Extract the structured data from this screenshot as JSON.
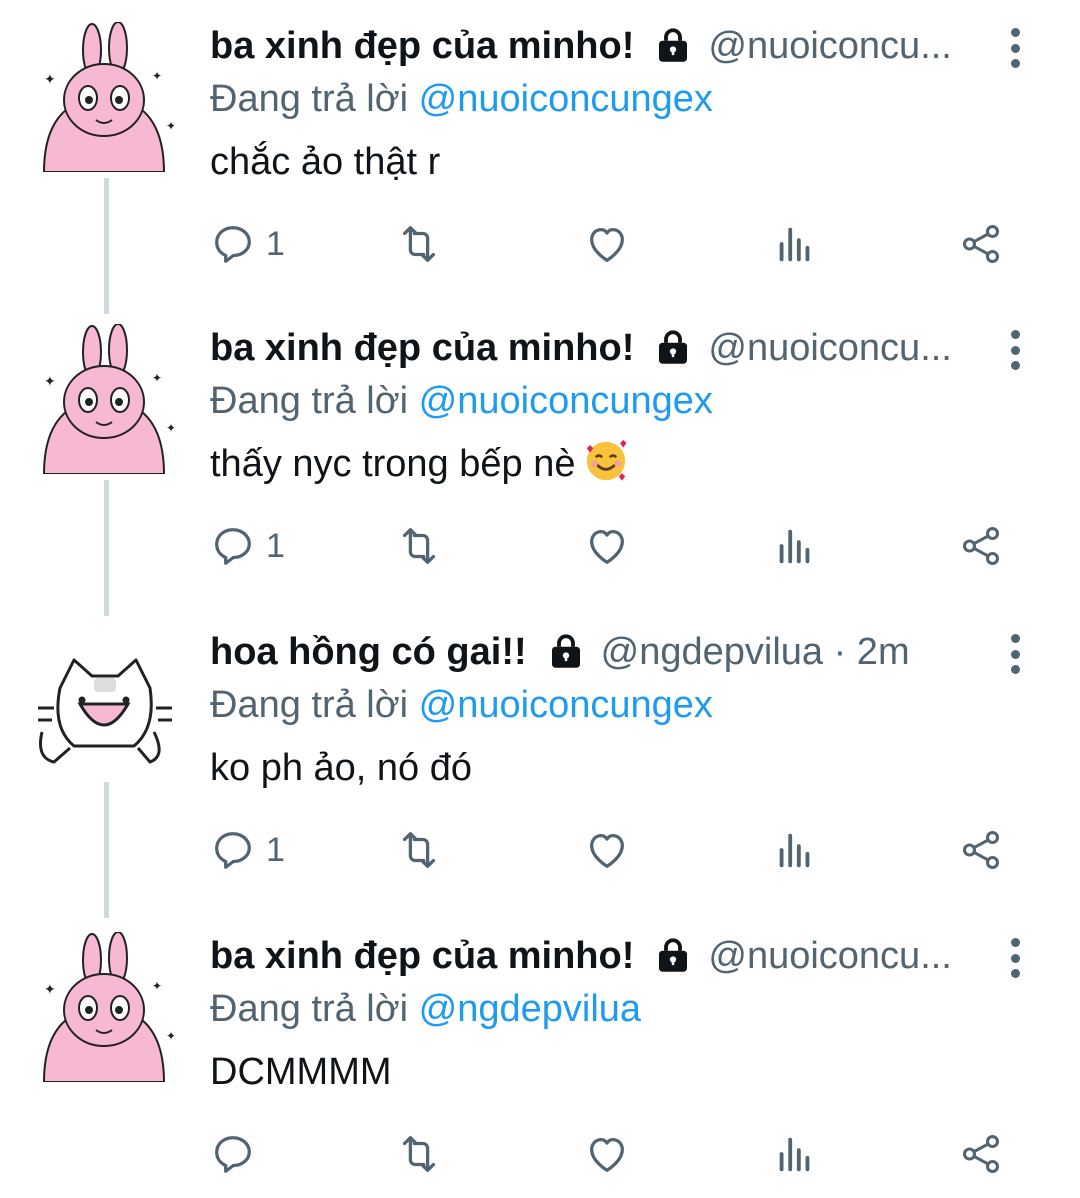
{
  "tweets": [
    {
      "name": "ba xinh đẹp của minho!",
      "handle": "@nuoiconcu...",
      "reply_prefix": "Đang trả lời",
      "reply_to": "@nuoiconcungex",
      "text": "chắc ảo thật r",
      "reply_count": "1",
      "avatar": "pink-bunny-avatar"
    },
    {
      "name": "ba xinh đẹp của minho!",
      "handle": "@nuoiconcu...",
      "reply_prefix": "Đang trả lời",
      "reply_to": "@nuoiconcungex",
      "text": "thấy nyc trong bếp nè",
      "emoji": "smiling-face-with-hearts",
      "reply_count": "1",
      "avatar": "pink-bunny-avatar"
    },
    {
      "name": "hoa hồng có gai!!",
      "handle": "@ngdepvilua · 2m",
      "reply_prefix": "Đang trả lời",
      "reply_to": "@nuoiconcungex",
      "text": "ko ph ảo, nó đó",
      "reply_count": "1",
      "avatar": "white-cat-doodle-avatar"
    },
    {
      "name": "ba xinh đẹp của minho!",
      "handle": "@nuoiconcu...",
      "reply_prefix": "Đang trả lời",
      "reply_to": "@ngdepvilua",
      "text": "DCMMMM",
      "reply_count": "",
      "avatar": "pink-bunny-avatar"
    }
  ],
  "icons": {
    "reply": "reply-icon",
    "retweet": "retweet-icon",
    "like": "heart-icon",
    "views": "views-chart-icon",
    "share": "share-icon",
    "lock": "lock-icon",
    "more": "more-vertical-icon"
  },
  "colors": {
    "text": "#0f1419",
    "secondary": "#536471",
    "link": "#1d9bf0",
    "thread_line": "#cfd9de",
    "avatar_pink": "#f6b8d3"
  }
}
